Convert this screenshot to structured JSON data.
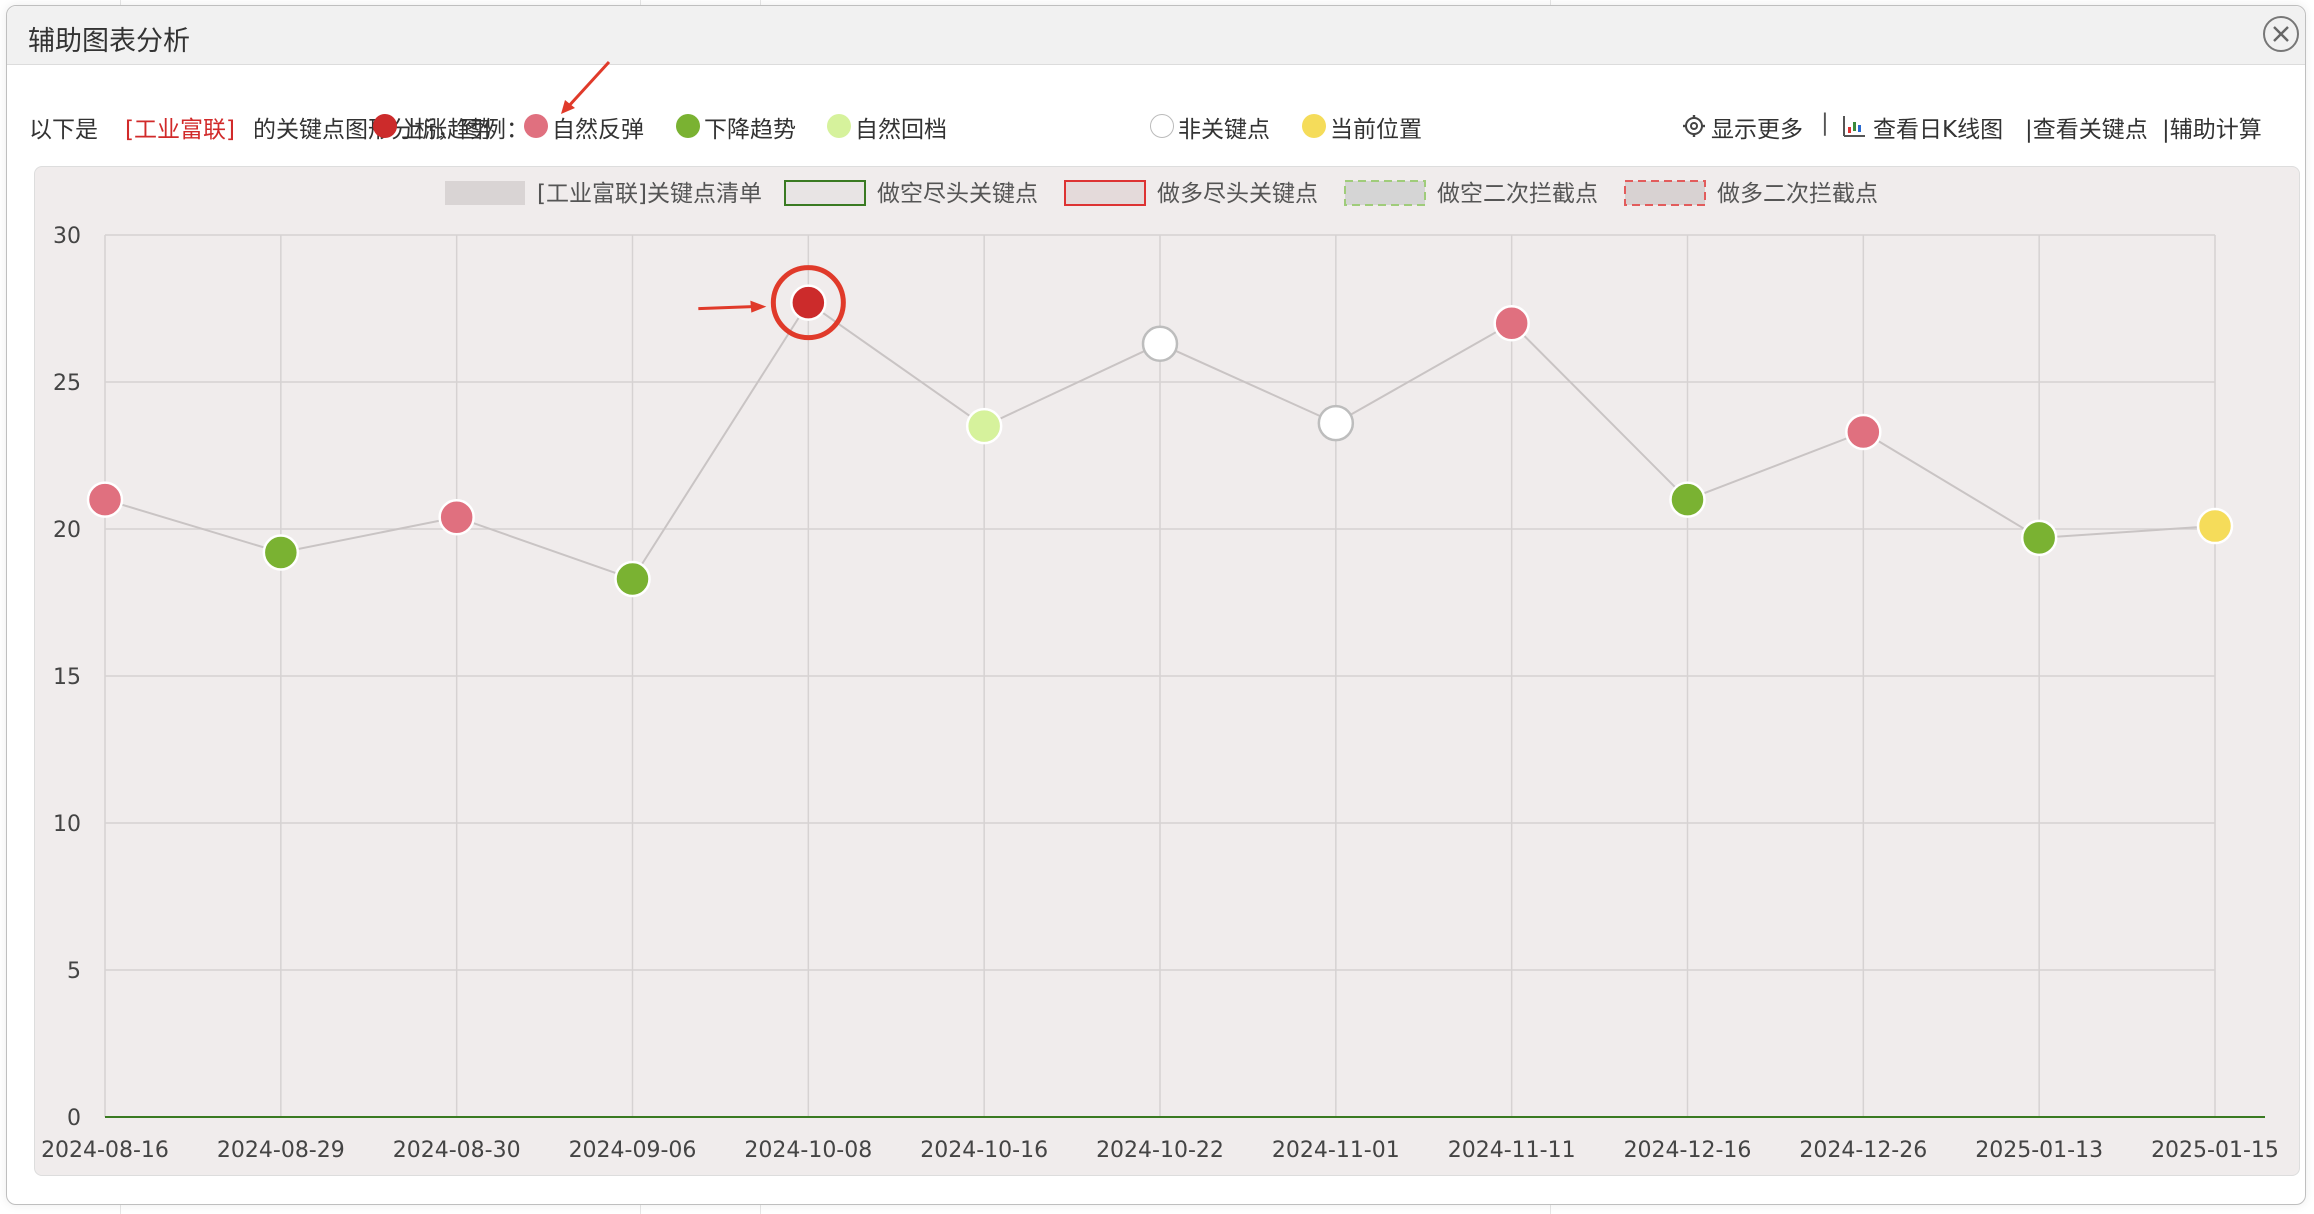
{
  "dialog": {
    "title": "辅助图表分析",
    "close_label": "✕"
  },
  "info": {
    "prefix": "以下是",
    "stock_name": "[工业富联]",
    "suffix": "的关键点图形分析，图例：",
    "legend": [
      {
        "label": "上涨趋势",
        "color": "#cc2b2b"
      },
      {
        "label": "自然反弹",
        "color": "#e0707f"
      },
      {
        "label": "下降趋势",
        "color": "#7ab232"
      },
      {
        "label": "自然回档",
        "color": "#d6f29c"
      },
      {
        "label": "非关键点",
        "color": "#ffffff"
      },
      {
        "label": "当前位置",
        "color": "#f5dc5a"
      }
    ]
  },
  "toolbar": {
    "show_more": "显示更多",
    "sep": "|",
    "kline": "查看日K线图",
    "keypoints": "|查看关键点",
    "calc": "|辅助计算",
    "show_more_icon": "settings-icon",
    "kline_icon": "chart-icon"
  },
  "chart_data": {
    "type": "line",
    "legend": [
      {
        "label": "[工业富联]关键点清单",
        "style": "fill",
        "fill": "#d9d4d4",
        "stroke": "#d9d4d4"
      },
      {
        "label": "做空尽头关键点",
        "style": "box",
        "fill": "#e8e4e4",
        "stroke": "#3a7a22"
      },
      {
        "label": "做多尽头关键点",
        "style": "box",
        "fill": "#e4dada",
        "stroke": "#d33"
      },
      {
        "label": "做空二次拦截点",
        "style": "dashed",
        "fill": "#d5d5d5",
        "stroke": "#9fcc7a"
      },
      {
        "label": "做多二次拦截点",
        "style": "dashed",
        "fill": "#d8d2d2",
        "stroke": "#e25c5c"
      }
    ],
    "categories": [
      "2024-08-16",
      "2024-08-29",
      "2024-08-30",
      "2024-09-06",
      "2024-10-08",
      "2024-10-16",
      "2024-10-22",
      "2024-11-01",
      "2024-11-11",
      "2024-12-16",
      "2024-12-26",
      "2025-01-13",
      "2025-01-15"
    ],
    "series": [
      {
        "values": [
          21.0,
          19.2,
          20.4,
          18.3,
          27.7,
          23.5,
          26.3,
          23.6,
          27.0,
          21.0,
          23.3,
          19.7,
          20.1
        ],
        "point_types": [
          "rebound",
          "down",
          "rebound",
          "down",
          "up",
          "pullback",
          "none",
          "none",
          "rebound",
          "down",
          "rebound",
          "down",
          "current"
        ]
      }
    ],
    "point_colors": {
      "up": "#cc2b2b",
      "rebound": "#e0707f",
      "down": "#7ab232",
      "pullback": "#d6f29c",
      "none": "#ffffff",
      "current": "#f5dc5a"
    },
    "ylim": [
      0,
      30
    ],
    "yticks": [
      0,
      5,
      10,
      15,
      20,
      25,
      30
    ],
    "grid": true,
    "highlight_index": 4
  }
}
